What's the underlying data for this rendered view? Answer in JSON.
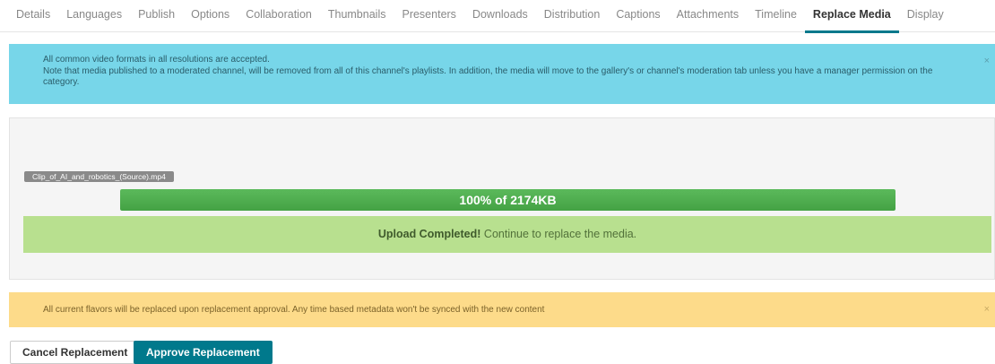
{
  "tabs": [
    {
      "label": "Details"
    },
    {
      "label": "Languages"
    },
    {
      "label": "Publish"
    },
    {
      "label": "Options"
    },
    {
      "label": "Collaboration"
    },
    {
      "label": "Thumbnails"
    },
    {
      "label": "Presenters"
    },
    {
      "label": "Downloads"
    },
    {
      "label": "Distribution"
    },
    {
      "label": "Captions"
    },
    {
      "label": "Attachments"
    },
    {
      "label": "Timeline"
    },
    {
      "label": "Replace Media",
      "active": true
    },
    {
      "label": "Display"
    }
  ],
  "info_alert": {
    "line1": "All common video formats in all resolutions are accepted.",
    "line2": "Note that media published to a moderated channel, will be removed from all of this channel's playlists. In addition, the media will move to the gallery's or channel's moderation tab unless you have a manager permission on the category.",
    "close": "×"
  },
  "upload": {
    "filename": "Clip_of_AI_and_robotics_(Source).mp4",
    "progress_percent": 100,
    "progress_label": "100% of 2174KB",
    "success_strong": "Upload Completed!",
    "success_text": " Continue to replace the media."
  },
  "warning_alert": {
    "text": "All current flavors will be replaced upon replacement approval. Any time based metadata won't be synced with the new content",
    "close": "×"
  },
  "buttons": {
    "cancel": "Cancel Replacement",
    "approve": "Approve Replacement"
  },
  "colors": {
    "accent": "#00798c",
    "info": "#77d6e9",
    "success": "#b8e08f",
    "warning": "#fddb8a",
    "progress": "#44a244"
  }
}
